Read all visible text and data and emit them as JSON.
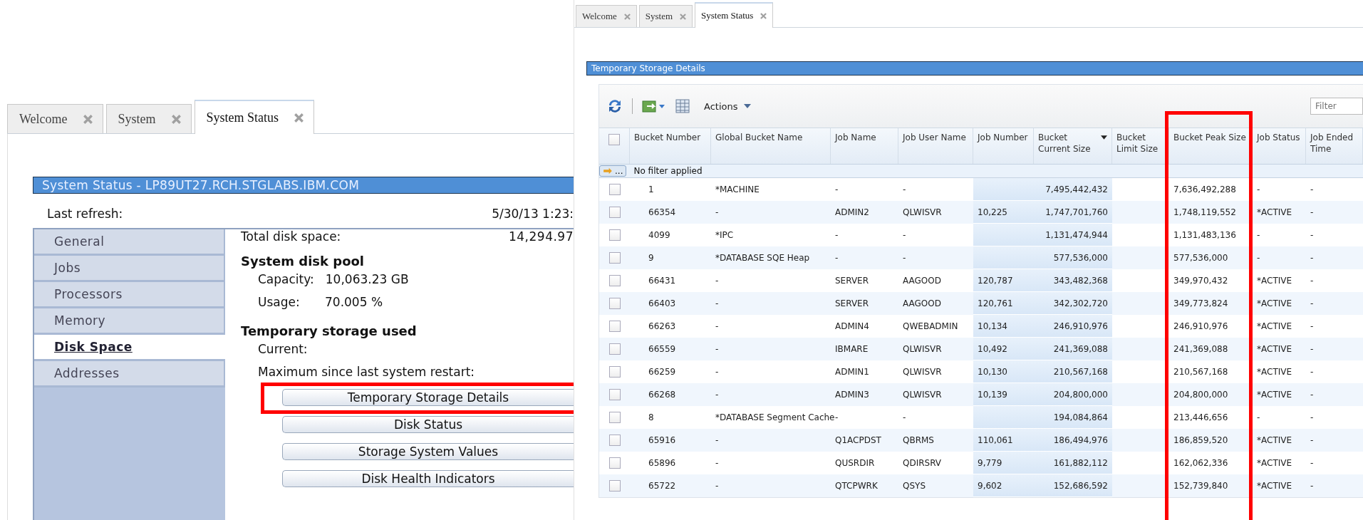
{
  "left_screen": {
    "tabs": [
      {
        "label": "Welcome",
        "selected": false
      },
      {
        "label": "System",
        "selected": false
      },
      {
        "label": "System Status",
        "selected": true
      }
    ],
    "panel_title": "System Status - LP89UT27.RCH.STGLABS.IBM.COM",
    "last_refresh_label": "Last refresh:",
    "last_refresh_value": "5/30/13 1:23:",
    "nav": [
      {
        "label": "General",
        "selected": false
      },
      {
        "label": "Jobs",
        "selected": false
      },
      {
        "label": "Processors",
        "selected": false
      },
      {
        "label": "Memory",
        "selected": false
      },
      {
        "label": "Disk Space",
        "selected": true
      },
      {
        "label": "Addresses",
        "selected": false
      }
    ],
    "details": [
      {
        "kind": "row",
        "label": "Total disk space:",
        "value": "14,294.97"
      },
      {
        "kind": "heading",
        "label": "System disk pool"
      },
      {
        "kind": "sub",
        "label": "Capacity:",
        "value": "10,063.23 GB"
      },
      {
        "kind": "sub",
        "label": "Usage:",
        "value": "70.005 %"
      },
      {
        "kind": "heading",
        "label": "Temporary storage used"
      },
      {
        "kind": "sub",
        "label": "Current:"
      },
      {
        "kind": "sub",
        "label": "Maximum since last system restart:"
      }
    ],
    "buttons": [
      "Temporary Storage Details",
      "Disk Status",
      "Storage System Values",
      "Disk Health Indicators"
    ]
  },
  "right_screen": {
    "tabs": [
      {
        "label": "Welcome",
        "selected": false
      },
      {
        "label": "System",
        "selected": false
      },
      {
        "label": "System Status",
        "selected": true
      }
    ],
    "panel_title": "Temporary Storage Details",
    "toolbar": {
      "actions_label": "Actions",
      "filter_placeholder": "Filter"
    },
    "table": {
      "select_all_checked": false,
      "filter_text": "No filter applied",
      "filter_button": "...",
      "columns": [
        {
          "label": "Bucket Number",
          "sorted": false,
          "highlighted": false
        },
        {
          "label": "Global Bucket Name",
          "sorted": false,
          "highlighted": false
        },
        {
          "label": "Job Name",
          "sorted": false,
          "highlighted": false
        },
        {
          "label": "Job User Name",
          "sorted": false,
          "highlighted": false
        },
        {
          "label": "Job Number",
          "sorted": false,
          "highlighted": true
        },
        {
          "label": "Bucket Current Size",
          "sorted": true,
          "highlighted": true
        },
        {
          "label": "Bucket Limit Size",
          "sorted": false,
          "highlighted": false
        },
        {
          "label": "Bucket Peak Size",
          "sorted": false,
          "highlighted": false
        },
        {
          "label": "Job Status",
          "sorted": false,
          "highlighted": false
        },
        {
          "label": "Job Ended Time",
          "sorted": false,
          "highlighted": false
        }
      ],
      "rows": [
        {
          "checked": false,
          "cells": [
            "1",
            "*MACHINE",
            "-",
            "-",
            "",
            "7,495,442,432",
            "",
            "7,636,492,288",
            "-",
            "-"
          ]
        },
        {
          "checked": false,
          "cells": [
            "66354",
            "-",
            "ADMIN2",
            "QLWISVR",
            "10,225",
            "1,747,701,760",
            "",
            "1,748,119,552",
            "*ACTIVE",
            "-"
          ]
        },
        {
          "checked": false,
          "cells": [
            "4099",
            "*IPC",
            "-",
            "-",
            "",
            "1,131,474,944",
            "",
            "1,131,483,136",
            "-",
            "-"
          ]
        },
        {
          "checked": false,
          "cells": [
            "9",
            "*DATABASE SQE Heap",
            "-",
            "-",
            "",
            "577,536,000",
            "",
            "577,536,000",
            "-",
            "-"
          ]
        },
        {
          "checked": false,
          "cells": [
            "66431",
            "-",
            "SERVER",
            "AAGOOD",
            "120,787",
            "343,482,368",
            "",
            "349,970,432",
            "*ACTIVE",
            "-"
          ]
        },
        {
          "checked": false,
          "cells": [
            "66403",
            "-",
            "SERVER",
            "AAGOOD",
            "120,761",
            "342,302,720",
            "",
            "349,773,824",
            "*ACTIVE",
            "-"
          ]
        },
        {
          "checked": false,
          "cells": [
            "66263",
            "-",
            "ADMIN4",
            "QWEBADMIN",
            "10,134",
            "246,910,976",
            "",
            "246,910,976",
            "*ACTIVE",
            "-"
          ]
        },
        {
          "checked": false,
          "cells": [
            "66559",
            "-",
            "IBMARE",
            "QLWISVR",
            "10,492",
            "241,369,088",
            "",
            "241,369,088",
            "*ACTIVE",
            "-"
          ]
        },
        {
          "checked": false,
          "cells": [
            "66259",
            "-",
            "ADMIN1",
            "QLWISVR",
            "10,130",
            "210,567,168",
            "",
            "210,567,168",
            "*ACTIVE",
            "-"
          ]
        },
        {
          "checked": false,
          "cells": [
            "66268",
            "-",
            "ADMIN3",
            "QLWISVR",
            "10,139",
            "204,800,000",
            "",
            "204,800,000",
            "*ACTIVE",
            "-"
          ]
        },
        {
          "checked": false,
          "cells": [
            "8",
            "*DATABASE Segment Cache",
            "-",
            "-",
            "",
            "194,084,864",
            "",
            "213,446,656",
            "-",
            "-"
          ]
        },
        {
          "checked": false,
          "cells": [
            "65916",
            "-",
            "Q1ACPDST",
            "QBRMS",
            "110,061",
            "186,494,976",
            "",
            "186,859,520",
            "*ACTIVE",
            "-"
          ]
        },
        {
          "checked": false,
          "cells": [
            "65896",
            "-",
            "QUSRDIR",
            "QDIRSRV",
            "9,779",
            "161,882,112",
            "",
            "162,062,336",
            "*ACTIVE",
            "-"
          ]
        },
        {
          "checked": false,
          "cells": [
            "65722",
            "-",
            "QTCPWRK",
            "QSYS",
            "9,602",
            "152,686,592",
            "",
            "152,739,840",
            "*ACTIVE",
            "-"
          ]
        }
      ]
    }
  }
}
